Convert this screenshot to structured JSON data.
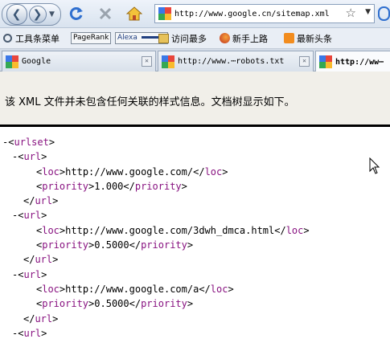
{
  "browser": {
    "url": "http://www.google.cn/sitemap.xml",
    "bookmarks": [
      {
        "label": "工具条菜单",
        "icon": "toolbar-gear-icon"
      },
      {
        "label": "PageRank",
        "icon": "pagerank-icon"
      },
      {
        "label": "Alexa",
        "icon": "alexa-icon"
      },
      {
        "label": "访问最多",
        "icon": "folder-icon"
      },
      {
        "label": "新手上路",
        "icon": "firefox-icon"
      },
      {
        "label": "最新头条",
        "icon": "rss-icon"
      }
    ],
    "tabs": [
      {
        "title": "Google"
      },
      {
        "title": "http://www.⋯robots.txt"
      },
      {
        "title": "http://ww⋯"
      }
    ]
  },
  "info_bar": {
    "text": "该 XML 文件并未包含任何关联的样式信息。文档树显示如下。"
  },
  "xml": {
    "root": "urlset",
    "url_tag": "url",
    "loc_tag": "loc",
    "priority_tag": "priority",
    "entries": [
      {
        "loc": "http://www.google.com/",
        "priority": "1.000"
      },
      {
        "loc": "http://www.google.com/3dwh_dmca.html",
        "priority": "0.5000"
      },
      {
        "loc": "http://www.google.com/a",
        "priority": "0.5000"
      }
    ]
  },
  "colors": {
    "tag": "#881280",
    "info_bg": "#f1efe9"
  }
}
